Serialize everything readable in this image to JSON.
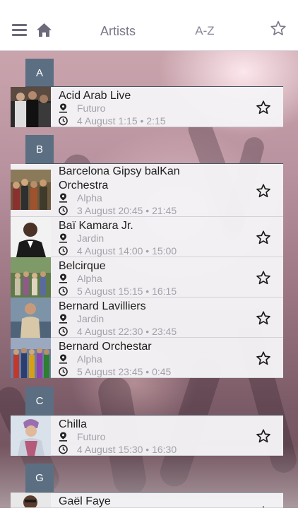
{
  "header": {
    "title": "Artists",
    "sort_label": "A-Z",
    "icons": [
      "hamburger-menu-icon",
      "home-icon",
      "star-icon"
    ]
  },
  "sections": [
    {
      "letter": "A",
      "items": [
        {
          "name": "Acid Arab Live",
          "stage": "Futuro",
          "time": "4 August 1:15 • 2:15"
        }
      ]
    },
    {
      "letter": "B",
      "items": [
        {
          "name": "Barcelona Gipsy balKan",
          "name2": "Orchestra",
          "stage": "Alpha",
          "time": "3 August 20:45 • 21:45"
        },
        {
          "name": "Baï Kamara Jr.",
          "stage": "Jardin",
          "time": "4 August 14:00 • 15:00"
        },
        {
          "name": "Belcirque",
          "stage": "Alpha",
          "time": "5 August 15:15 • 16:15"
        },
        {
          "name": "Bernard Lavilliers",
          "stage": "Jardin",
          "time": "4 August 22:30 • 23:45"
        },
        {
          "name": "Bernard Orchestar",
          "stage": "Alpha",
          "time": "5 August 23:45 • 0:45"
        }
      ]
    },
    {
      "letter": "C",
      "items": [
        {
          "name": "Chilla",
          "stage": "Futuro",
          "time": "4 August 15:30 • 16:30"
        }
      ]
    },
    {
      "letter": "G",
      "items": [
        {
          "name": "Gaël Faye"
        }
      ]
    }
  ],
  "colors": {
    "section_tab": "#5c6f82",
    "row_bg": "#f4f3f5",
    "meta_text": "#a3a1aa",
    "header_text": "#7a7788"
  }
}
